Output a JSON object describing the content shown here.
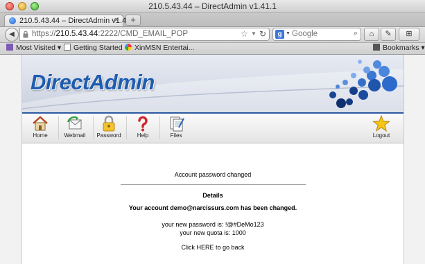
{
  "window": {
    "title": "210.5.43.44 – DirectAdmin v1.41.1"
  },
  "tabs": [
    {
      "label": "210.5.43.44 – DirectAdmin v1.4...",
      "close": "×"
    }
  ],
  "new_tab": "+",
  "url": {
    "prefix": "https://",
    "host": "210.5.43.44",
    "path": ":2222/CMD_EMAIL_POP"
  },
  "search": {
    "placeholder": "Google",
    "engine": "g"
  },
  "bookmarks": {
    "items": [
      {
        "label": "Most Visited ▾"
      },
      {
        "label": "Getting Started"
      },
      {
        "label": "XinMSN Entertai..."
      }
    ],
    "menu": "Bookmarks ▾"
  },
  "directadmin": {
    "logo": "DirectAdmin",
    "toolbar": {
      "home": "Home",
      "webmail": "Webmail",
      "password": "Password",
      "help": "Help",
      "files": "Files",
      "logout": "Logout"
    },
    "accent": "#1d5cb0"
  },
  "content": {
    "status": "Account password changed",
    "details_heading": "Details",
    "account_changed": "Your account demo@narcissurs.com has been changed.",
    "new_password": "your new password is: !@#DeMo123",
    "new_quota": "your new quota is: 1000",
    "back_link": "Click HERE to go back"
  }
}
